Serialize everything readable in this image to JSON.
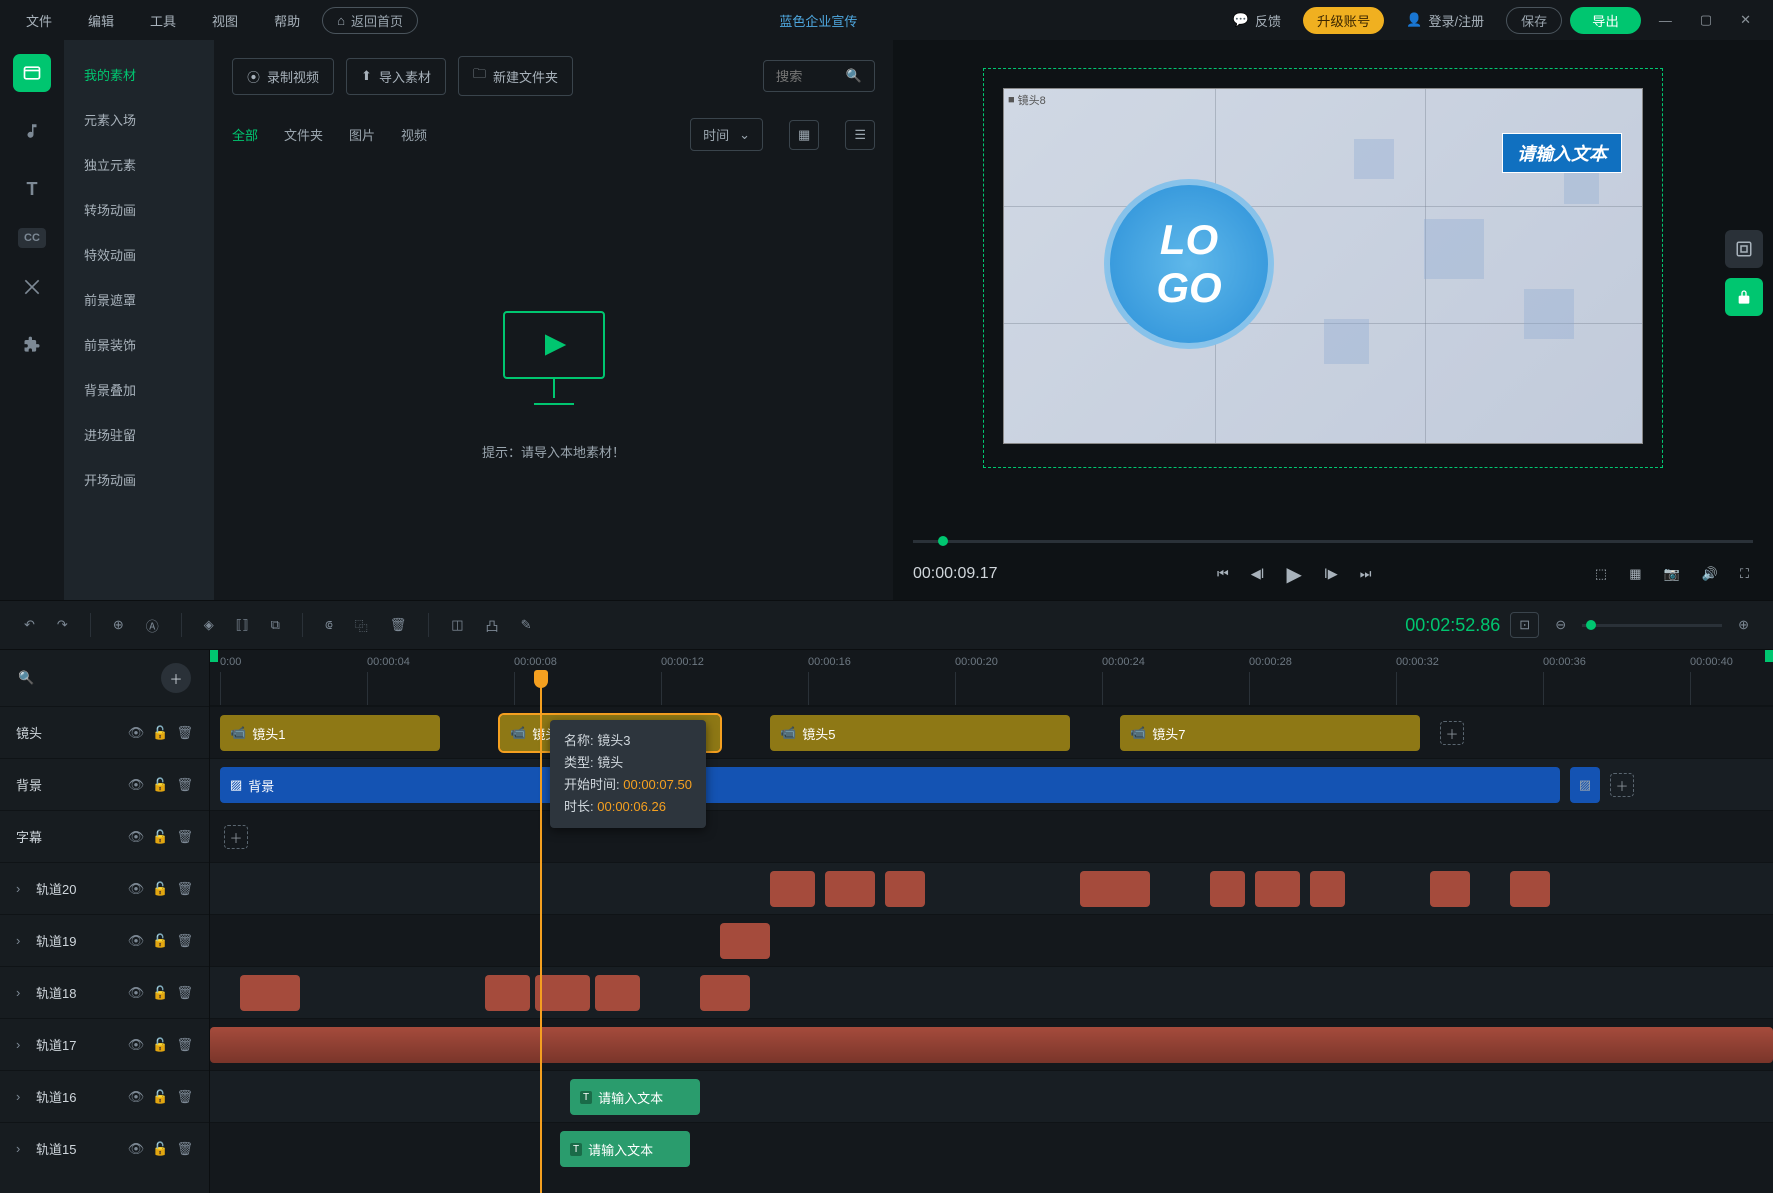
{
  "menu": {
    "file": "文件",
    "edit": "编辑",
    "tools": "工具",
    "view": "视图",
    "help": "帮助",
    "home": "返回首页"
  },
  "title": "蓝色企业宣传",
  "top": {
    "feedback": "反馈",
    "upgrade": "升级账号",
    "login": "登录/注册",
    "save": "保存",
    "export": "导出"
  },
  "categories": [
    "我的素材",
    "元素入场",
    "独立元素",
    "转场动画",
    "特效动画",
    "前景遮罩",
    "前景装饰",
    "背景叠加",
    "进场驻留",
    "开场动画"
  ],
  "mediaToolbar": {
    "record": "录制视频",
    "import": "导入素材",
    "newFolder": "新建文件夹",
    "searchPlaceholder": "搜索"
  },
  "mediaFilter": {
    "all": "全部",
    "folder": "文件夹",
    "image": "图片",
    "video": "视频",
    "sort": "时间"
  },
  "emptyHint": "提示：请导入本地素材！",
  "preview": {
    "tc": "00:00:09.17",
    "textBox": "请输入文本",
    "shotLabel": "镜头8",
    "logoTop": "LO",
    "logoBot": "GO"
  },
  "actionbar": {
    "tc": "00:02:52.86"
  },
  "ruler": [
    "0:00",
    "00:00:04",
    "00:00:08",
    "00:00:12",
    "00:00:16",
    "00:00:20",
    "00:00:24",
    "00:00:28",
    "00:00:32",
    "00:00:36",
    "00:00:40"
  ],
  "tracks": {
    "shot": "镜头",
    "bg": "背景",
    "subtitle": "字幕",
    "t20": "轨道20",
    "t19": "轨道19",
    "t18": "轨道18",
    "t17": "轨道17",
    "t16": "轨道16",
    "t15": "轨道15"
  },
  "shots": [
    "镜头1",
    "镜头3",
    "镜头5",
    "镜头7"
  ],
  "bgClip": "背景",
  "textClip": "请输入文本",
  "tooltip": {
    "nameLbl": "名称:",
    "name": "镜头3",
    "typeLbl": "类型:",
    "type": "镜头",
    "startLbl": "开始时间:",
    "start": "00:00:07.50",
    "durLbl": "时长:",
    "dur": "00:00:06.26"
  }
}
